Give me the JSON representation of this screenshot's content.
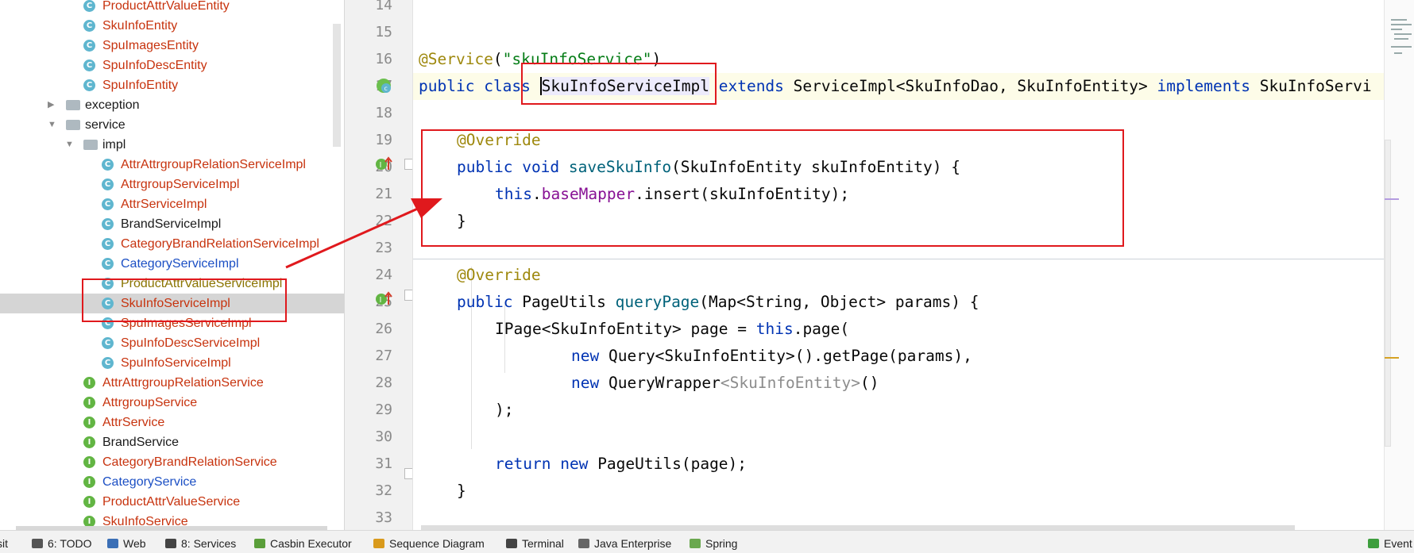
{
  "project_tree": {
    "items": [
      {
        "label": "ProductAttrValueEntity",
        "type": "class",
        "color": "red"
      },
      {
        "label": "SkuInfoEntity",
        "type": "class",
        "color": "red"
      },
      {
        "label": "SpuImagesEntity",
        "type": "class",
        "color": "red"
      },
      {
        "label": "SpuInfoDescEntity",
        "type": "class",
        "color": "red"
      },
      {
        "label": "SpuInfoEntity",
        "type": "class",
        "color": "red"
      },
      {
        "label": "exception",
        "type": "folder",
        "color": "black"
      },
      {
        "label": "service",
        "type": "folder",
        "color": "black"
      },
      {
        "label": "impl",
        "type": "folder",
        "color": "black"
      },
      {
        "label": "AttrAttrgroupRelationServiceImpl",
        "type": "class",
        "color": "red"
      },
      {
        "label": "AttrgroupServiceImpl",
        "type": "class",
        "color": "red"
      },
      {
        "label": "AttrServiceImpl",
        "type": "class",
        "color": "red"
      },
      {
        "label": "BrandServiceImpl",
        "type": "class",
        "color": "black"
      },
      {
        "label": "CategoryBrandRelationServiceImpl",
        "type": "class",
        "color": "red"
      },
      {
        "label": "CategoryServiceImpl",
        "type": "class",
        "color": "blue"
      },
      {
        "label": "ProductAttrValueServiceImpl",
        "type": "class",
        "color": "olive"
      },
      {
        "label": "SkuInfoServiceImpl",
        "type": "class",
        "color": "red",
        "selected": true
      },
      {
        "label": "SpuImagesServiceImpl",
        "type": "class",
        "color": "red"
      },
      {
        "label": "SpuInfoDescServiceImpl",
        "type": "class",
        "color": "red"
      },
      {
        "label": "SpuInfoServiceImpl",
        "type": "class",
        "color": "red"
      },
      {
        "label": "AttrAttrgroupRelationService",
        "type": "interface",
        "color": "red"
      },
      {
        "label": "AttrgroupService",
        "type": "interface",
        "color": "red"
      },
      {
        "label": "AttrService",
        "type": "interface",
        "color": "red"
      },
      {
        "label": "BrandService",
        "type": "interface",
        "color": "black"
      },
      {
        "label": "CategoryBrandRelationService",
        "type": "interface",
        "color": "red"
      },
      {
        "label": "CategoryService",
        "type": "interface",
        "color": "blue"
      },
      {
        "label": "ProductAttrValueService",
        "type": "interface",
        "color": "red"
      },
      {
        "label": "SkuInfoService",
        "type": "interface",
        "color": "red"
      }
    ]
  },
  "editor": {
    "line_numbers": [
      "14",
      "15",
      "16",
      "17",
      "18",
      "19",
      "20",
      "21",
      "22",
      "23",
      "24",
      "25",
      "26",
      "27",
      "28",
      "29",
      "30",
      "31",
      "32",
      "33"
    ],
    "code": {
      "l16": {
        "annotation": "@Service",
        "open": "(",
        "str": "\"skuInfoService\"",
        "close": ")"
      },
      "l17": {
        "kw1": "public",
        "kw2": "class",
        "cls": "SkuInfoServiceImpl",
        "kw3": "extends",
        "rest": "ServiceImpl<SkuInfoDao, SkuInfoEntity>",
        "kw4": "implements",
        "iface": "SkuInfoServi"
      },
      "l19": {
        "annotation": "@Override"
      },
      "l20": {
        "kw1": "public",
        "kw2": "void",
        "fn": "saveSkuInfo",
        "args": "(SkuInfoEntity skuInfoEntity) {"
      },
      "l21": {
        "kw": "this",
        "dot": ".",
        "field": "baseMapper",
        "rest": ".insert(skuInfoEntity);"
      },
      "l22": {
        "text": "}"
      },
      "l24": {
        "annotation": "@Override"
      },
      "l25": {
        "kw1": "public",
        "type": "PageUtils",
        "fn": "queryPage",
        "args": "(Map<String, Object> params) {"
      },
      "l26": {
        "pre": "IPage<SkuInfoEntity> page = ",
        "kw": "this",
        "rest": ".page("
      },
      "l27": {
        "kw": "new",
        "rest": "Query<SkuInfoEntity>().getPage(params),"
      },
      "l28": {
        "kw": "new",
        "cls": "QueryWrapper",
        "gen": "<SkuInfoEntity>",
        "rest": "()"
      },
      "l29": {
        "text": ");"
      },
      "l31": {
        "kw": "return",
        "kw2": "new",
        "rest": "PageUtils(page);"
      },
      "l32": {
        "text": "}"
      }
    }
  },
  "status_bar": {
    "items": [
      {
        "label": "sit",
        "color": "#f2f2f2"
      },
      {
        "label": "6: TODO",
        "color": "#555555"
      },
      {
        "label": "Web",
        "color": "#3b6fb6"
      },
      {
        "label": "8: Services",
        "color": "#444444"
      },
      {
        "label": "Casbin Executor",
        "color": "#5a9e3a"
      },
      {
        "label": "Sequence Diagram",
        "color": "#d99a1c"
      },
      {
        "label": "Terminal",
        "color": "#444444"
      },
      {
        "label": "Java Enterprise",
        "color": "#666666"
      },
      {
        "label": "Spring",
        "color": "#6aa84f"
      },
      {
        "label": "Event L",
        "color": "#3e9e3e"
      }
    ]
  },
  "colors": {
    "annotation_box": "#e0191d",
    "keyword": "#0033b3",
    "annotation": "#9e880d",
    "string": "#067d17",
    "method": "#00627a",
    "field": "#871094"
  }
}
